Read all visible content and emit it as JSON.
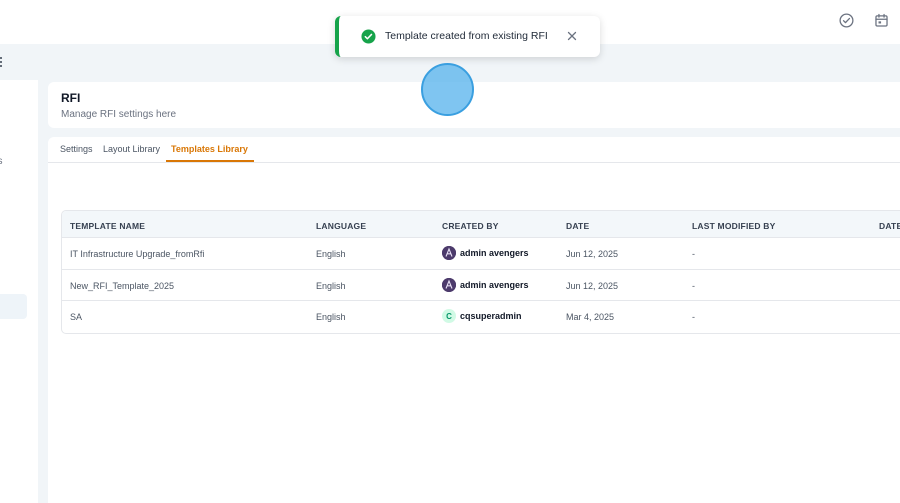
{
  "header": {
    "icons": [
      "check-circle-icon",
      "calendar-icon"
    ]
  },
  "sidebar": {
    "fragment_text": "es"
  },
  "page": {
    "title": "RFI",
    "subtitle": "Manage RFI settings here"
  },
  "tabs": [
    {
      "label": "Settings",
      "active": false
    },
    {
      "label": "Layout Library",
      "active": false
    },
    {
      "label": "Templates Library",
      "active": true
    }
  ],
  "table": {
    "columns": [
      "TEMPLATE NAME",
      "LANGUAGE",
      "CREATED BY",
      "DATE",
      "LAST MODIFIED BY",
      "DATE"
    ],
    "rows": [
      {
        "name": "IT Infrastructure Upgrade_fromRfi",
        "language": "English",
        "created_by": "admin avengers",
        "avatar": "admin-avatar",
        "date": "Jun 12, 2025",
        "last_modified_by": "-"
      },
      {
        "name": "New_RFI_Template_2025",
        "language": "English",
        "created_by": "admin avengers",
        "avatar": "admin-avatar",
        "date": "Jun 12, 2025",
        "last_modified_by": "-"
      },
      {
        "name": "SA",
        "language": "English",
        "created_by": "cqsuperadmin",
        "avatar_letter": "C",
        "date": "Mar 4, 2025",
        "last_modified_by": "-"
      }
    ]
  },
  "toast": {
    "message": "Template created from existing RFI",
    "status_color": "#16a34a"
  },
  "colors": {
    "accent": "#d97706",
    "success": "#16a34a"
  }
}
